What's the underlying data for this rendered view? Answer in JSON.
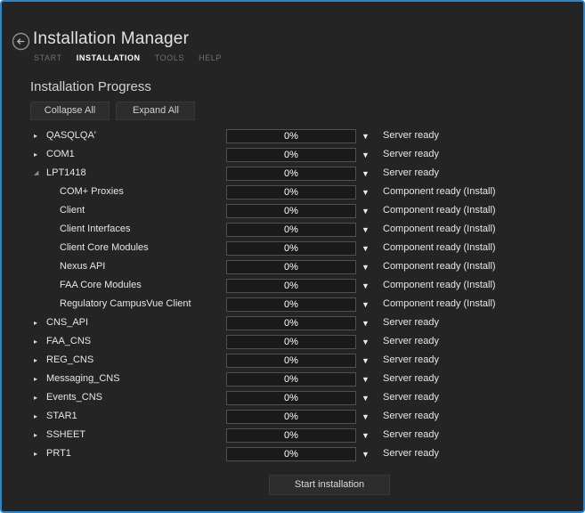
{
  "window": {
    "accent_border_color": "#2e86c8",
    "background_color": "#242424"
  },
  "header": {
    "title": "Installation Manager",
    "back_icon": "back-arrow-circle",
    "tabs": [
      {
        "label": "START",
        "active": false
      },
      {
        "label": "INSTALLATION",
        "active": true
      },
      {
        "label": "TOOLS",
        "active": false
      },
      {
        "label": "HELP",
        "active": false
      }
    ]
  },
  "page": {
    "heading": "Installation Progress"
  },
  "toolbar": {
    "collapse_all_label": "Collapse All",
    "expand_all_label": "Expand All"
  },
  "tree": {
    "expander_glyphs": {
      "collapsed": "▸",
      "expanded": "◢",
      "none": ""
    },
    "dropdown_glyph": "▼",
    "rows": [
      {
        "label": "QASQLQA'",
        "level": 0,
        "expander": "collapsed",
        "progress": "0%",
        "status": "Server ready"
      },
      {
        "label": "COM1",
        "level": 0,
        "expander": "collapsed",
        "progress": "0%",
        "status": "Server ready"
      },
      {
        "label": "LPT1418",
        "level": 0,
        "expander": "expanded",
        "progress": "0%",
        "status": "Server ready"
      },
      {
        "label": "COM+ Proxies",
        "level": 1,
        "expander": "none",
        "progress": "0%",
        "status": "Component ready (Install)"
      },
      {
        "label": "Client",
        "level": 1,
        "expander": "none",
        "progress": "0%",
        "status": "Component ready (Install)"
      },
      {
        "label": "Client Interfaces",
        "level": 1,
        "expander": "none",
        "progress": "0%",
        "status": "Component ready (Install)"
      },
      {
        "label": "Client Core Modules",
        "level": 1,
        "expander": "none",
        "progress": "0%",
        "status": "Component ready (Install)"
      },
      {
        "label": "Nexus API",
        "level": 1,
        "expander": "none",
        "progress": "0%",
        "status": "Component ready (Install)"
      },
      {
        "label": "FAA Core Modules",
        "level": 1,
        "expander": "none",
        "progress": "0%",
        "status": "Component ready (Install)"
      },
      {
        "label": "Regulatory CampusVue Client",
        "level": 1,
        "expander": "none",
        "progress": "0%",
        "status": "Component ready (Install)"
      },
      {
        "label": "CNS_API",
        "level": 0,
        "expander": "collapsed",
        "progress": "0%",
        "status": "Server ready"
      },
      {
        "label": "FAA_CNS",
        "level": 0,
        "expander": "collapsed",
        "progress": "0%",
        "status": "Server ready"
      },
      {
        "label": "REG_CNS",
        "level": 0,
        "expander": "collapsed",
        "progress": "0%",
        "status": "Server ready"
      },
      {
        "label": "Messaging_CNS",
        "level": 0,
        "expander": "collapsed",
        "progress": "0%",
        "status": "Server ready"
      },
      {
        "label": "Events_CNS",
        "level": 0,
        "expander": "collapsed",
        "progress": "0%",
        "status": "Server ready"
      },
      {
        "label": "STAR1",
        "level": 0,
        "expander": "collapsed",
        "progress": "0%",
        "status": "Server ready"
      },
      {
        "label": "SSHEET",
        "level": 0,
        "expander": "collapsed",
        "progress": "0%",
        "status": "Server ready"
      },
      {
        "label": "PRT1",
        "level": 0,
        "expander": "collapsed",
        "progress": "0%",
        "status": "Server ready"
      }
    ]
  },
  "footer": {
    "start_button_label": "Start installation"
  }
}
